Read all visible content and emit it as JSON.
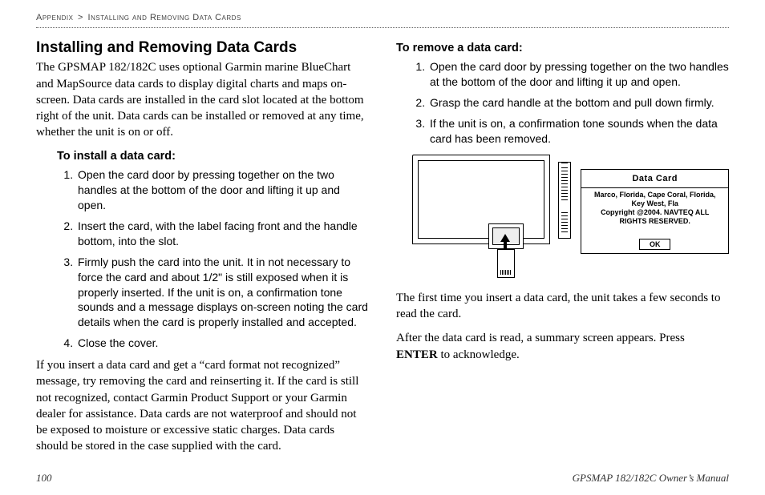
{
  "breadcrumb": {
    "part1": "Appendix",
    "sep": ">",
    "part2": "Installing and Removing Data Cards"
  },
  "left": {
    "heading": "Installing and Removing Data Cards",
    "intro": "The GPSMAP 182/182C uses optional Garmin marine BlueChart and MapSource data cards to display digital charts and maps on-screen. Data cards are installed in the card slot located at the bottom right of the unit. Data cards can be installed or removed at any time, whether the unit is on or off.",
    "install_head": "To install a data card:",
    "install_steps": [
      "Open the card door by pressing together on the two handles at the bottom of the door and lifting it up and open.",
      "Insert the card, with the label facing front and the handle bottom, into the slot.",
      "Firmly push the card into the unit. It in not necessary to force the card and about 1/2\" is still exposed when it is properly inserted. If the unit is on, a confirmation tone sounds and a message displays on-screen noting the card details when the card is properly installed and accepted.",
      "Close the cover."
    ],
    "trouble": "If you insert a data card and get a “card format not recognized” message, try removing the card and reinserting it. If the card is still not recognized, contact Garmin Product Support or your Garmin dealer for assistance. Data cards are not waterproof and should not be exposed to moisture or excessive static charges. Data cards should be stored in the case supplied with the card."
  },
  "right": {
    "remove_head": "To remove a data card:",
    "remove_steps": [
      "Open the card door by pressing together on the two handles at the bottom of the door and lifting it up and open.",
      "Grasp the card handle at the bottom and pull down firmly.",
      "If the unit is on, a confirmation tone sounds when the data card has been removed."
    ],
    "popup": {
      "title": "Data Card",
      "line1": "Marco, Florida, Cape Coral, Florida,",
      "line2": "Key West, Fla",
      "line3": "Copyright @2004. NAVTEQ ALL",
      "line4": "RIGHTS RESERVED.",
      "ok": "OK"
    },
    "after1": "The first time you insert a data card, the unit takes a few seconds to read the card.",
    "after2_a": "After the data card is read, a summary screen appears. Press ",
    "after2_bold": "ENTER",
    "after2_b": " to acknowledge."
  },
  "footer": {
    "page": "100",
    "title": "GPSMAP 182/182C Owner’s Manual"
  }
}
